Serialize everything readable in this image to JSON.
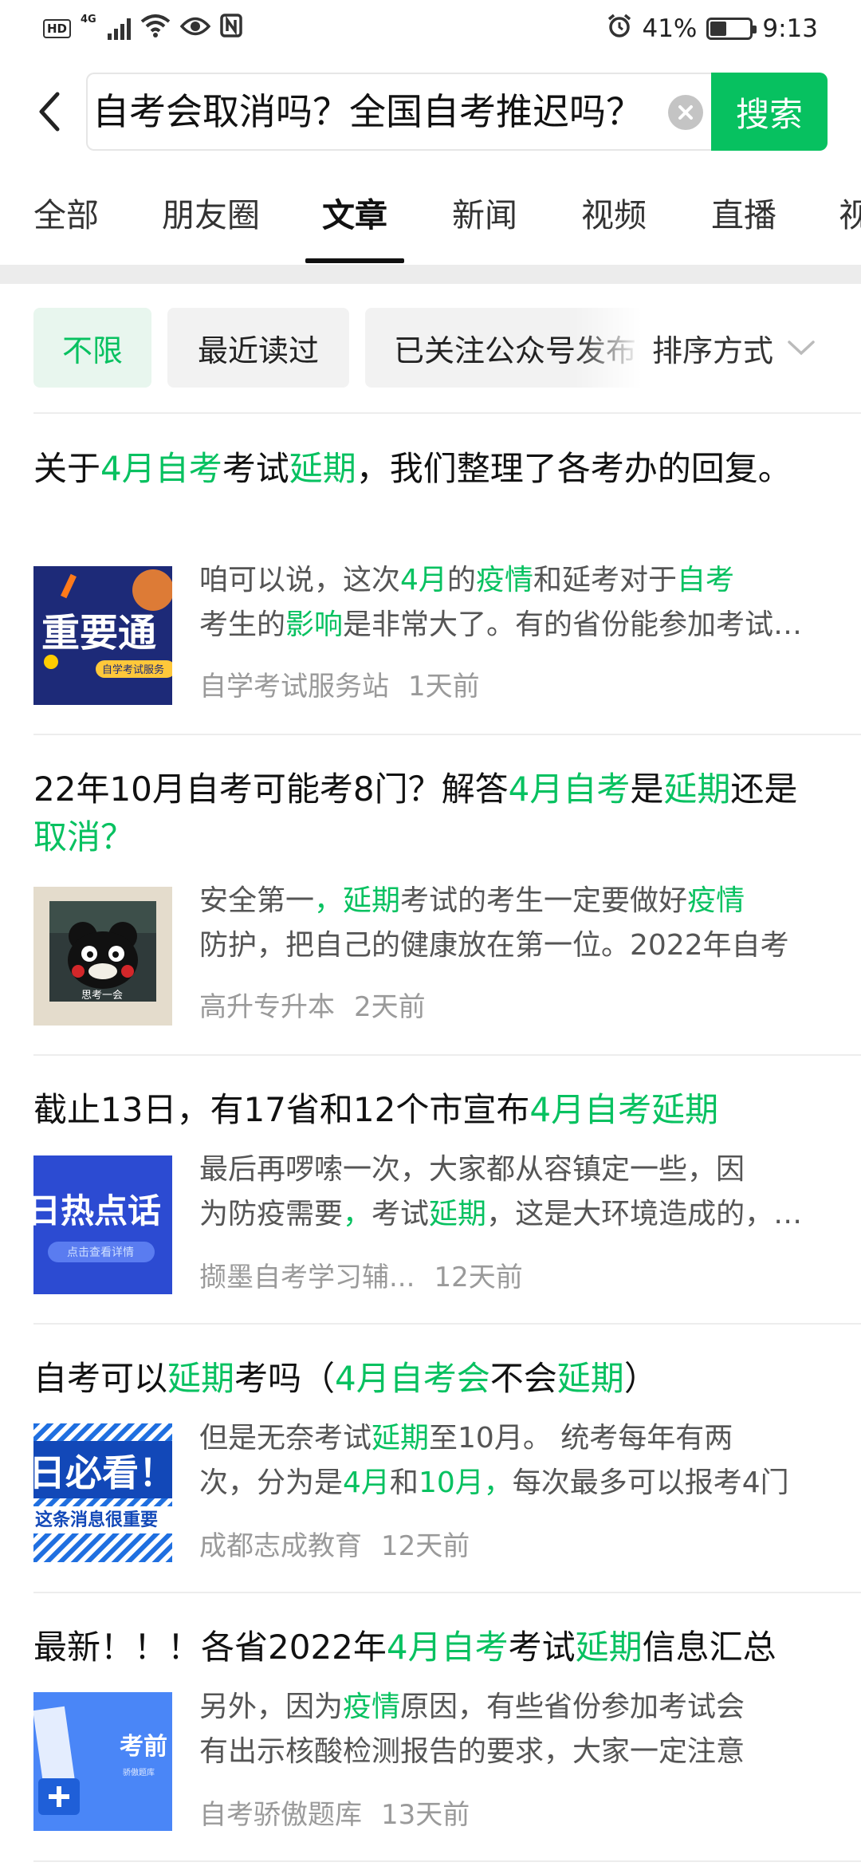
{
  "status_bar": {
    "network_label": "4G",
    "hd_label": "HD",
    "battery_percent": "41%",
    "battery_level": 0.41,
    "time": "9:13"
  },
  "search": {
    "query": "自考会取消吗？全国自考推迟吗？",
    "button_label": "搜索"
  },
  "tabs": [
    {
      "label": "全部",
      "active": false
    },
    {
      "label": "朋友圈",
      "active": false
    },
    {
      "label": "文章",
      "active": true
    },
    {
      "label": "新闻",
      "active": false
    },
    {
      "label": "视频",
      "active": false
    },
    {
      "label": "直播",
      "active": false
    },
    {
      "label": "视",
      "active": false
    }
  ],
  "filters": {
    "chips": [
      {
        "label": "不限",
        "active": true
      },
      {
        "label": "最近读过",
        "active": false
      },
      {
        "label": "已关注公众号发布",
        "active": false
      }
    ],
    "sort_label": "排序方式"
  },
  "results": [
    {
      "title_parts": [
        {
          "text": "关于",
          "hl": false
        },
        {
          "text": "4月自考",
          "hl": true
        },
        {
          "text": "考试",
          "hl": false
        },
        {
          "text": "延期",
          "hl": true
        },
        {
          "text": "，我们整理了各考办的回复。",
          "hl": false
        }
      ],
      "snippet_lines": [
        [
          {
            "text": "咱可以说，这次",
            "hl": false
          },
          {
            "text": "4月",
            "hl": true
          },
          {
            "text": "的",
            "hl": false
          },
          {
            "text": "疫情",
            "hl": true
          },
          {
            "text": "和延考对于",
            "hl": false
          },
          {
            "text": "自考",
            "hl": true
          }
        ],
        [
          {
            "text": "考生的",
            "hl": false
          },
          {
            "text": "影响",
            "hl": true
          },
          {
            "text": "是非常大了。有的省份能参加考试的考生",
            "hl": false
          }
        ]
      ],
      "source": "自学考试服务站",
      "time": "1天前",
      "thumb": {
        "type": "notice",
        "text": "重要通",
        "subtext": "自学考试服务"
      }
    },
    {
      "title_parts": [
        {
          "text": "22年10月自考可能考8门？解答",
          "hl": false
        },
        {
          "text": "4月自考",
          "hl": true
        },
        {
          "text": "是",
          "hl": false
        },
        {
          "text": "延期",
          "hl": true
        },
        {
          "text": "还是",
          "hl": false
        },
        {
          "text": "取消？",
          "hl": true
        }
      ],
      "snippet_lines": [
        [
          {
            "text": "安全第一",
            "hl": false
          },
          {
            "text": "，",
            "hl": true
          },
          {
            "text": "延期",
            "hl": true
          },
          {
            "text": "考试的考生一定要做好",
            "hl": false
          },
          {
            "text": "疫情",
            "hl": true
          }
        ],
        [
          {
            "text": "防护，把自己的健康放在第一位。2022年自考",
            "hl": false
          }
        ]
      ],
      "source": "高升专升本",
      "time": "2天前",
      "thumb": {
        "type": "bear",
        "text": "思考一会"
      }
    },
    {
      "title_parts": [
        {
          "text": "截止13日，有17省和12个市宣布",
          "hl": false
        },
        {
          "text": "4月自考延期",
          "hl": true
        }
      ],
      "snippet_lines": [
        [
          {
            "text": "最后再啰嗦一次，大家都从容镇定一些，因",
            "hl": false
          }
        ],
        [
          {
            "text": "为防疫需要",
            "hl": false
          },
          {
            "text": "，",
            "hl": true
          },
          {
            "text": "考试",
            "hl": false
          },
          {
            "text": "延期",
            "hl": true
          },
          {
            "text": "，这是大环境造成的，大家",
            "hl": false
          }
        ]
      ],
      "source": "撷墨自考学习辅...",
      "time": "12天前",
      "thumb": {
        "type": "hot",
        "text": "日热点话",
        "subtext": "点击查看详情"
      }
    },
    {
      "title_parts": [
        {
          "text": "自考可以",
          "hl": false
        },
        {
          "text": "延期",
          "hl": true
        },
        {
          "text": "考吗（",
          "hl": false
        },
        {
          "text": "4月自考会",
          "hl": true
        },
        {
          "text": "不会",
          "hl": false
        },
        {
          "text": "延期",
          "hl": true
        },
        {
          "text": "）",
          "hl": false
        }
      ],
      "snippet_lines": [
        [
          {
            "text": "但是无奈考试",
            "hl": false
          },
          {
            "text": "延期",
            "hl": true
          },
          {
            "text": "至10月。 统考每年有两",
            "hl": false
          }
        ],
        [
          {
            "text": "次，分为是",
            "hl": false
          },
          {
            "text": "4月",
            "hl": true
          },
          {
            "text": "和",
            "hl": false
          },
          {
            "text": "10月",
            "hl": true
          },
          {
            "text": "，",
            "hl": true
          },
          {
            "text": "每次最多可以报考4门",
            "hl": false
          }
        ]
      ],
      "source": "成都志成教育",
      "time": "12天前",
      "thumb": {
        "type": "must",
        "text": "日必看！",
        "subtext": "这条消息很重要"
      }
    },
    {
      "title_parts": [
        {
          "text": "最新！！！各省2022年",
          "hl": false
        },
        {
          "text": "4月自考",
          "hl": true
        },
        {
          "text": "考试",
          "hl": false
        },
        {
          "text": "延期",
          "hl": true
        },
        {
          "text": "信息汇总",
          "hl": false
        }
      ],
      "snippet_lines": [
        [
          {
            "text": "另外，因为",
            "hl": false
          },
          {
            "text": "疫情",
            "hl": true
          },
          {
            "text": "原因，有些省份参加考试会",
            "hl": false
          }
        ],
        [
          {
            "text": "有出示核酸检测报告的要求，大家一定注意",
            "hl": false
          }
        ]
      ],
      "source": "自考骄傲题库",
      "time": "13天前",
      "thumb": {
        "type": "exam",
        "text": "考前",
        "subtext": "骄傲题库"
      }
    }
  ]
}
